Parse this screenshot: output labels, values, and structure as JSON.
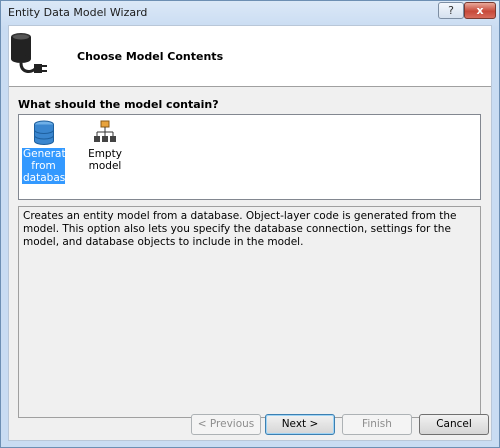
{
  "window": {
    "title": "Entity Data Model Wizard",
    "help_label": "?",
    "close_label": "x"
  },
  "header": {
    "title": "Choose Model Contents",
    "icon": "database-plug-icon"
  },
  "question": "What should the model contain?",
  "options": [
    {
      "label_lines": [
        "Generate",
        "from",
        "database"
      ],
      "icon": "database-icon",
      "selected": true
    },
    {
      "label_lines": [
        "Empty model"
      ],
      "icon": "hierarchy-icon",
      "selected": false
    }
  ],
  "description": "Creates an entity model from a database. Object-layer code is generated from the model. This option also lets you specify the database connection, settings for the model, and database objects to include in the model.",
  "buttons": {
    "previous": "< Previous",
    "next": "Next >",
    "finish": "Finish",
    "cancel": "Cancel"
  },
  "colors": {
    "selection": "#3399ff",
    "titlebar": "#c9dcf2",
    "close": "#c7493a"
  }
}
